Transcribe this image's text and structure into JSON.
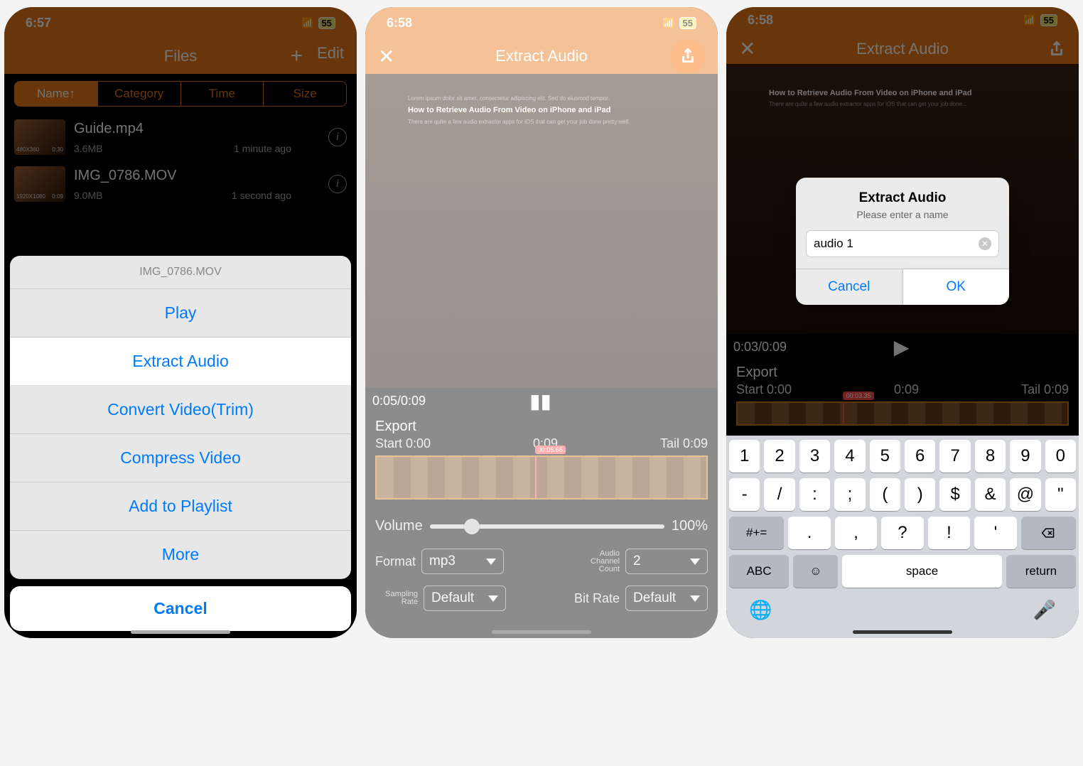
{
  "screen1": {
    "status": {
      "time": "6:57",
      "battery": "55"
    },
    "nav": {
      "title": "Files",
      "edit": "Edit"
    },
    "sort": {
      "name": "Name↑",
      "category": "Category",
      "time": "Time",
      "size": "Size"
    },
    "files": [
      {
        "name": "Guide.mp4",
        "size": "3.6MB",
        "age": "1 minute ago",
        "reso": "480X360",
        "dur": "0:30"
      },
      {
        "name": "IMG_0786.MOV",
        "size": "9.0MB",
        "age": "1 second ago",
        "reso": "1920X1080",
        "dur": "0:09"
      }
    ],
    "sheet": {
      "head": "IMG_0786.MOV",
      "items": [
        "Play",
        "Extract Audio",
        "Convert Video(Trim)",
        "Compress Video",
        "Add to Playlist",
        "More"
      ],
      "cancel": "Cancel"
    }
  },
  "screen2": {
    "status": {
      "time": "6:58",
      "battery": "55"
    },
    "nav": {
      "title": "Extract Audio"
    },
    "playtime": "0:05/0:09",
    "mock_heading": "How to Retrieve Audio From Video on iPhone and iPad",
    "export": {
      "title": "Export",
      "start": "Start 0:00",
      "mid": "0:09",
      "tail": "Tail 0:09",
      "playhead": "00:05.66"
    },
    "volume": {
      "label": "Volume",
      "value": "100%"
    },
    "format": {
      "label": "Format",
      "value": "mp3"
    },
    "channels": {
      "label": "Audio Channel Count",
      "value": "2"
    },
    "sampling": {
      "label": "Sampling Rate",
      "value": "Default"
    },
    "bitrate": {
      "label": "Bit Rate",
      "value": "Default"
    }
  },
  "screen3": {
    "status": {
      "time": "6:58",
      "battery": "55"
    },
    "nav": {
      "title": "Extract Audio"
    },
    "playtime": "0:03/0:09",
    "export": {
      "title": "Export",
      "start": "Start 0:00",
      "mid": "0:09",
      "tail": "Tail 0:09",
      "playhead": "00:03.35"
    },
    "alert": {
      "title": "Extract Audio",
      "subtitle": "Please enter a name",
      "value": "audio 1",
      "cancel": "Cancel",
      "ok": "OK"
    },
    "keyboard": {
      "row1": [
        "1",
        "2",
        "3",
        "4",
        "5",
        "6",
        "7",
        "8",
        "9",
        "0"
      ],
      "row2": [
        "-",
        "/",
        ":",
        ";",
        "(",
        ")",
        "$",
        "&",
        "@",
        "\""
      ],
      "row3_shift": "#+=",
      "row3": [
        ".",
        ",",
        "?",
        "!",
        "'"
      ],
      "row4_abc": "ABC",
      "row4_space": "space",
      "row4_return": "return"
    }
  }
}
